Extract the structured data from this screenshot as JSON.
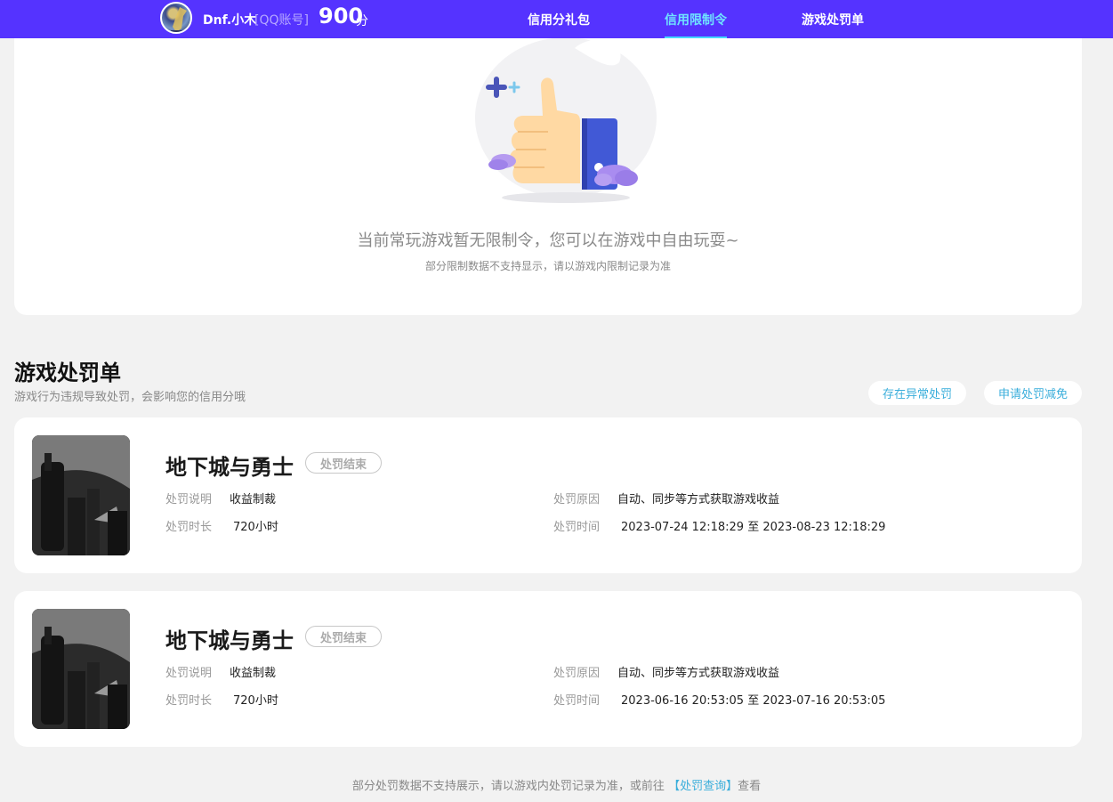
{
  "header": {
    "user_name": "Dnf.小木",
    "account_type": "[QQ账号]",
    "score": "900",
    "score_unit": "分",
    "tabs": [
      {
        "label": "信用分礼包"
      },
      {
        "label": "信用限制令"
      },
      {
        "label": "游戏处罚单"
      }
    ],
    "active_tab_color": "#6fe3ff",
    "bar_color": "#5533ff"
  },
  "restriction": {
    "empty_title": "当前常玩游戏暂无限制令，您可以在游戏中自由玩耍~",
    "empty_subtitle": "部分限制数据不支持显示，请以游戏内限制记录为准"
  },
  "penalty_section": {
    "title": "游戏处罚单",
    "subtitle": "游戏行为违规导致处罚，会影响您的信用分哦",
    "buttons": {
      "abnormal": "存在异常处罚",
      "reduce": "申请处罚减免"
    },
    "labels": {
      "description": "处罚说明",
      "duration": "处罚时长",
      "reason": "处罚原因",
      "time": "处罚时间"
    },
    "records": [
      {
        "game": "地下城与勇士",
        "status": "处罚结束",
        "description": "收益制裁",
        "duration": "720小时",
        "reason": "自动、同步等方式获取游戏收益",
        "time": "2023-07-24 12:18:29 至 2023-08-23 12:18:29"
      },
      {
        "game": "地下城与勇士",
        "status": "处罚结束",
        "description": "收益制裁",
        "duration": "720小时",
        "reason": "自动、同步等方式获取游戏收益",
        "time": "2023-06-16 20:53:05 至 2023-07-16 20:53:05"
      }
    ]
  },
  "footer": {
    "note_prefix": "部分处罚数据不支持展示，请以游戏内处罚记录为准，或前往",
    "link": "【处罚查询】",
    "note_suffix": "查看"
  }
}
